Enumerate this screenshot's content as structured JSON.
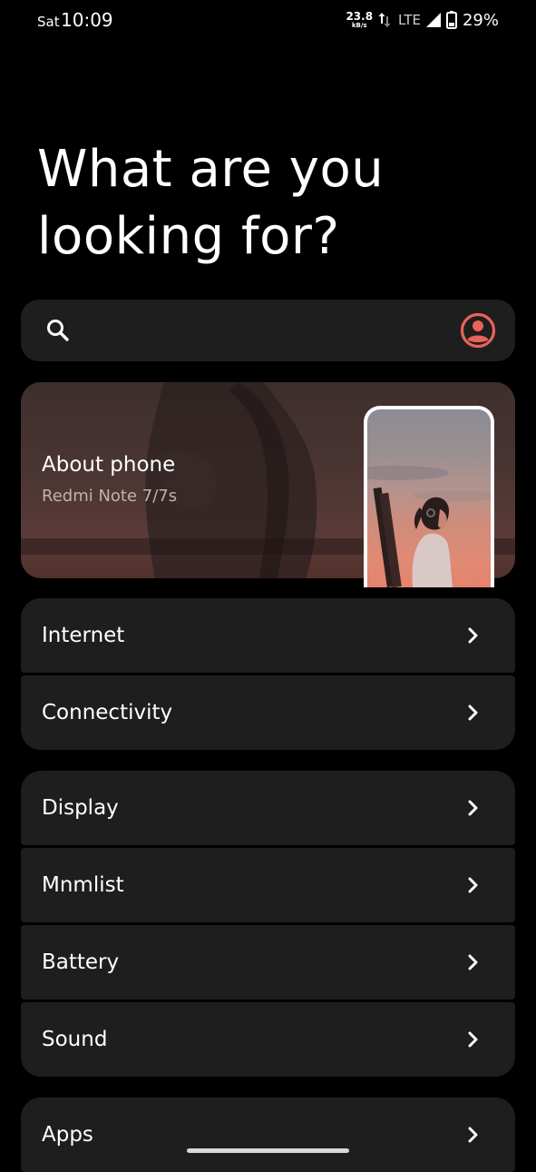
{
  "status_bar": {
    "day": "Sat",
    "time": "10:09",
    "speed_value": "23.8",
    "speed_unit": "kB/s",
    "network": "LTE",
    "battery_percent": "29%"
  },
  "header": {
    "title_line1": "What are you",
    "title_line2": "looking for?"
  },
  "search": {
    "icon": "search-icon",
    "account_icon": "account-circle-icon",
    "accent_color": "#e8635b"
  },
  "about_card": {
    "title": "About phone",
    "subtitle": "Redmi Note 7/7s"
  },
  "groups": [
    {
      "items": [
        {
          "label": "Internet"
        },
        {
          "label": "Connectivity"
        }
      ]
    },
    {
      "items": [
        {
          "label": "Display"
        },
        {
          "label": "Mnmlist"
        },
        {
          "label": "Battery"
        },
        {
          "label": "Sound"
        }
      ]
    },
    {
      "items": [
        {
          "label": "Apps"
        }
      ]
    }
  ],
  "colors": {
    "background": "#000000",
    "card": "#1e1e1e",
    "text": "#ffffff",
    "subtext": "#bdb3b1"
  }
}
